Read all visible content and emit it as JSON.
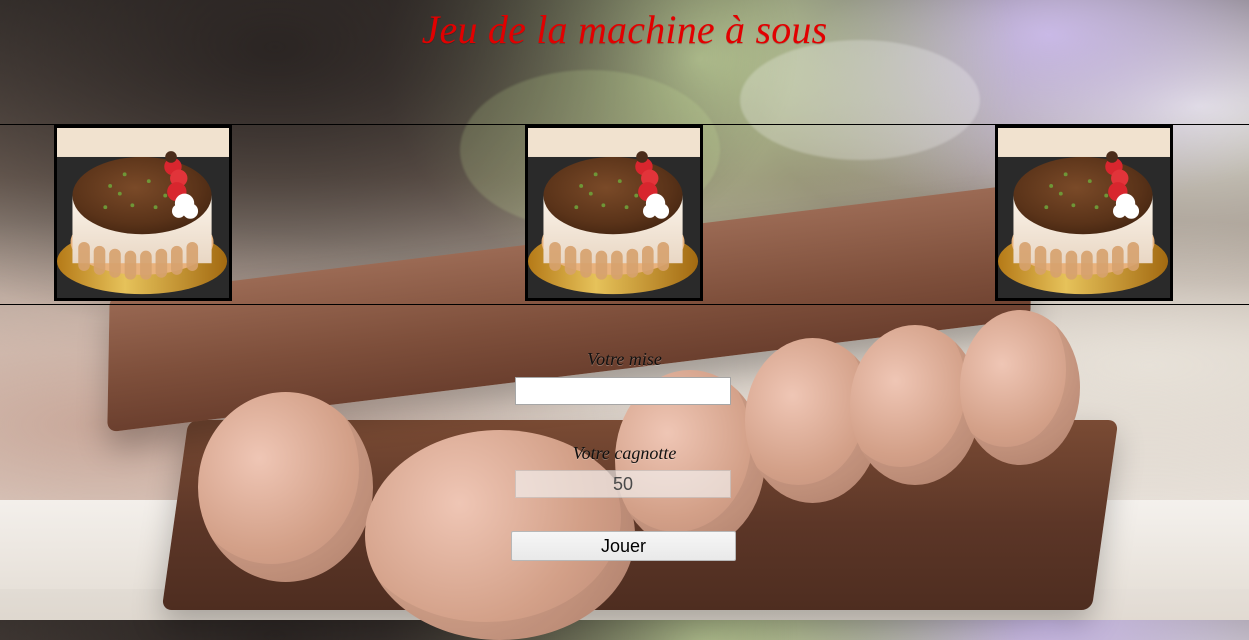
{
  "title": "Jeu de la machine à sous",
  "reels": [
    {
      "symbol": "dessert-cake"
    },
    {
      "symbol": "dessert-cake"
    },
    {
      "symbol": "dessert-cake"
    }
  ],
  "bet": {
    "label": "Votre mise",
    "value": "",
    "placeholder": ""
  },
  "bank": {
    "label": "Votre cagnotte",
    "value": "50"
  },
  "play_button": {
    "label": "Jouer"
  },
  "colors": {
    "title": "#e20000",
    "reel_border": "#000000"
  }
}
